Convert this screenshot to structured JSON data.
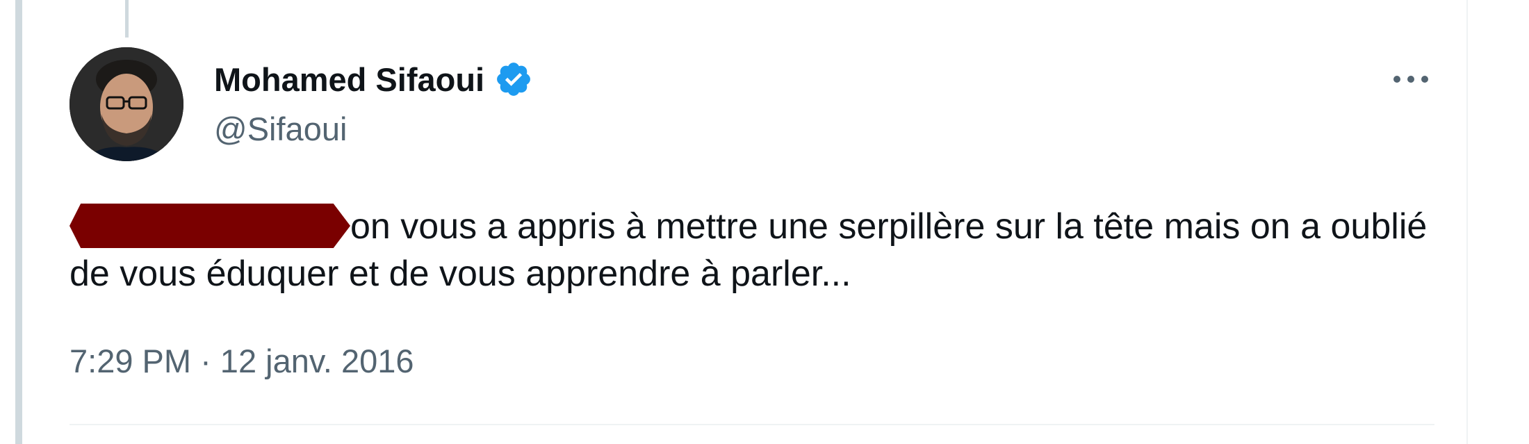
{
  "tweet": {
    "user_name": "Mohamed Sifaoui",
    "user_handle": "@Sifaoui",
    "text": "on vous a appris à mettre une serpillère sur la tête mais on a oublié de vous éduquer et de vous apprendre à parler...",
    "timestamp": "7:29 PM · 12 janv. 2016",
    "verified": true
  },
  "icons": {
    "verified": "verified-badge-icon",
    "more": "more-options-icon"
  },
  "colors": {
    "verified_blue": "#1d9bf0",
    "text_primary": "#0f1419",
    "text_secondary": "#536471",
    "redaction": "#7a0000",
    "rule": "#cfd9de"
  }
}
